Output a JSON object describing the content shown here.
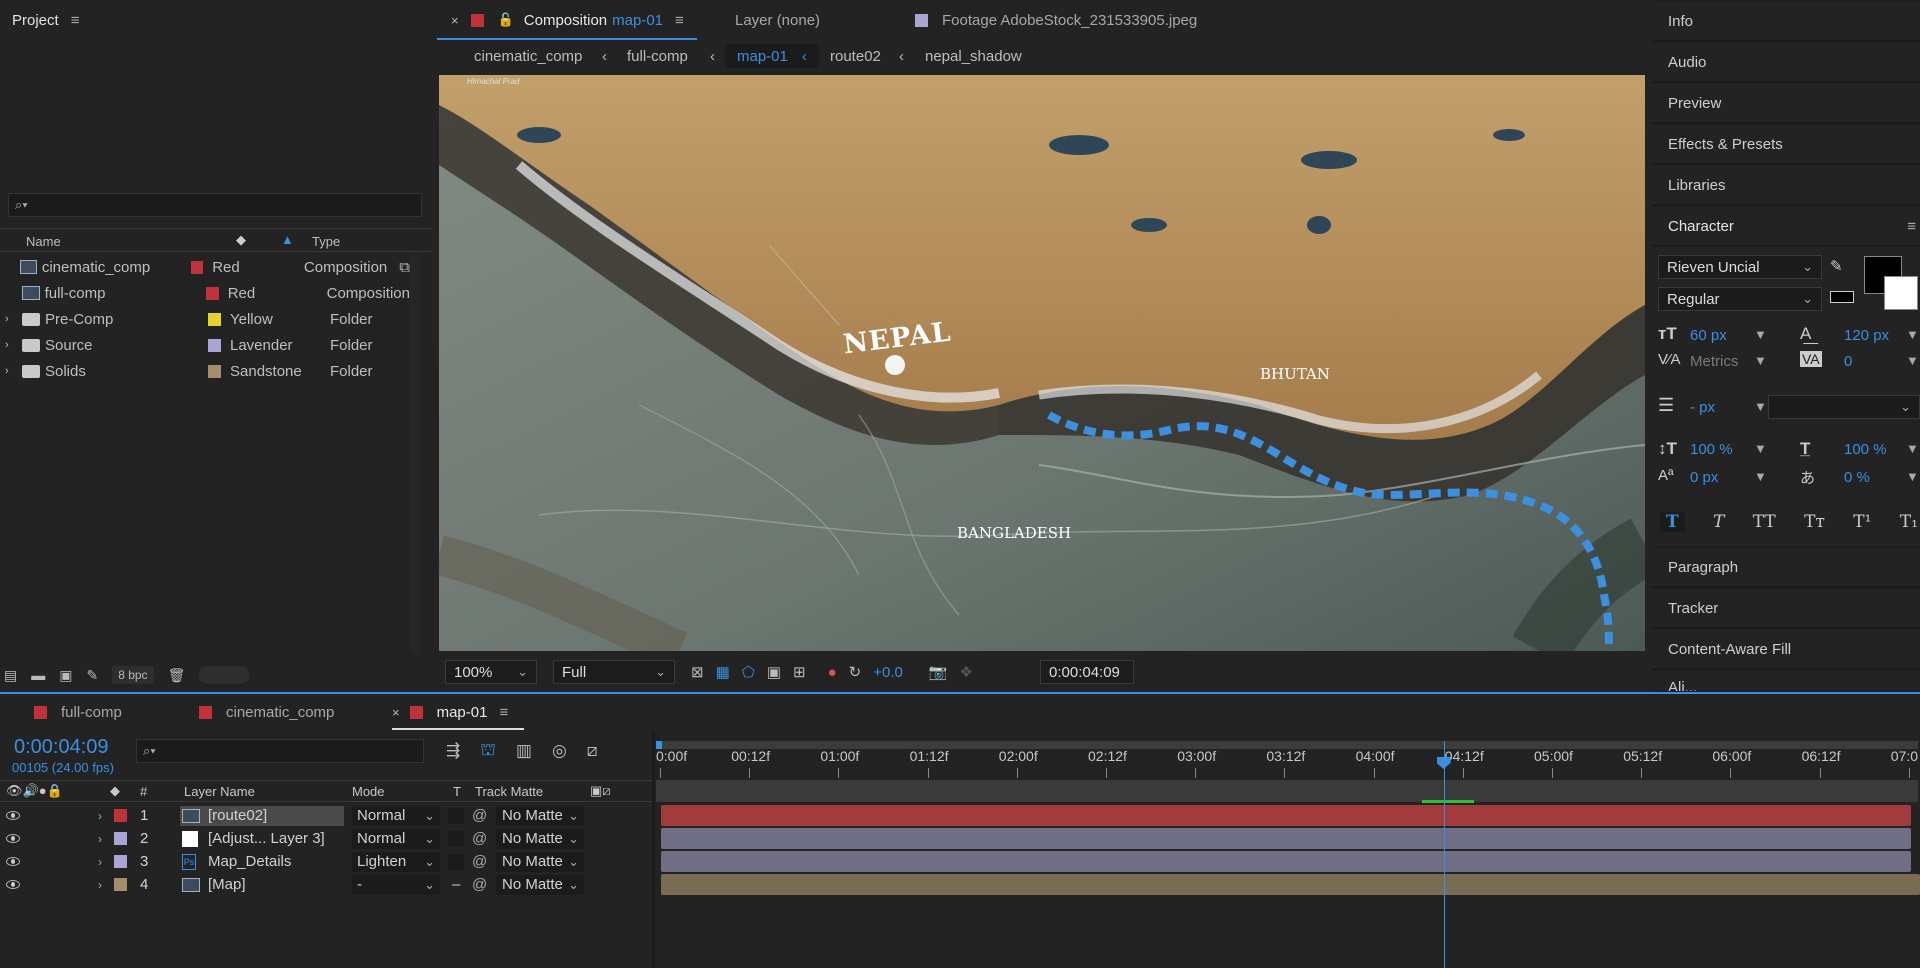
{
  "project": {
    "title": "Project",
    "search_placeholder": "",
    "col_name": "Name",
    "col_type": "Type",
    "items": [
      {
        "name": "cinematic_comp",
        "label": "Red",
        "color": "#c0333a",
        "type": "Composition",
        "kind": "comp"
      },
      {
        "name": "full-comp",
        "label": "Red",
        "color": "#c0333a",
        "type": "Composition",
        "kind": "comp"
      },
      {
        "name": "Pre-Comp",
        "label": "Yellow",
        "color": "#e6d22d",
        "type": "Folder",
        "kind": "folder"
      },
      {
        "name": "Source",
        "label": "Lavender",
        "color": "#a9a6d6",
        "type": "Folder",
        "kind": "folder"
      },
      {
        "name": "Solids",
        "label": "Sandstone",
        "color": "#a58c6b",
        "type": "Folder",
        "kind": "folder"
      }
    ],
    "bpc": "8 bpc"
  },
  "viewer": {
    "tab_comp_prefix": "Composition",
    "tab_comp_name": "map-01",
    "tab_layer": "Layer (none)",
    "tab_footage": "Footage AdobeStock_231533905.jpeg",
    "crumbs": [
      "cinematic_comp",
      "full-comp",
      "map-01",
      "route02",
      "nepal_shadow"
    ],
    "map_labels": {
      "nepal": "NEPAL",
      "bhutan": "BHUTAN",
      "bangladesh": "BANGLADESH",
      "corner": "Himachal Prad"
    },
    "zoom": "100%",
    "resolution": "Full",
    "exposure": "+0.0",
    "timecode": "0:00:04:09"
  },
  "right_panel": {
    "items_top": [
      "Info",
      "Audio",
      "Preview",
      "Effects & Presets",
      "Libraries"
    ],
    "character_title": "Character",
    "font": "Rieven Uncial",
    "style": "Regular",
    "font_size": "60 px",
    "leading": "120 px",
    "kerning": "Metrics",
    "tracking": "0",
    "stroke": "- px",
    "vscale": "100 %",
    "hscale": "100 %",
    "baseline": "0 px",
    "tsume": "0 %",
    "items_bottom": [
      "Paragraph",
      "Tracker",
      "Content-Aware Fill",
      "Ali..."
    ]
  },
  "timeline": {
    "tabs": [
      "full-comp",
      "cinematic_comp",
      "map-01"
    ],
    "timecode": "0:00:04:09",
    "frames": "00105 (24.00 fps)",
    "col_hash": "#",
    "col_layer": "Layer Name",
    "col_mode": "Mode",
    "col_t": "T",
    "col_matte": "Track Matte",
    "ruler": [
      "0:00f",
      "00:12f",
      "01:00f",
      "01:12f",
      "02:00f",
      "02:12f",
      "03:00f",
      "03:12f",
      "04:00f",
      "04:12f",
      "05:00f",
      "05:12f",
      "06:00f",
      "06:12f",
      "07:0"
    ],
    "playhead_fraction": 0.617,
    "layers": [
      {
        "num": "1",
        "name": "[route02]",
        "color": "#c0333a",
        "mode": "Normal",
        "matte": "No Matte",
        "bar": "#a23b3d"
      },
      {
        "num": "2",
        "name": "[Adjust... Layer 3]",
        "color": "#a9a6d6",
        "mode": "Normal",
        "matte": "No Matte",
        "bar": "#6f6e84"
      },
      {
        "num": "3",
        "name": "Map_Details",
        "color": "#a9a6d6",
        "mode": "Lighten",
        "matte": "No Matte",
        "bar": "#6f6e84"
      },
      {
        "num": "4",
        "name": "[Map]",
        "color": "#a58c6b",
        "mode": "-",
        "matte": "No Matte",
        "bar": "#7a6b55"
      }
    ]
  },
  "colors": {
    "accent": "#3a8fe3",
    "bg": "#232323"
  }
}
